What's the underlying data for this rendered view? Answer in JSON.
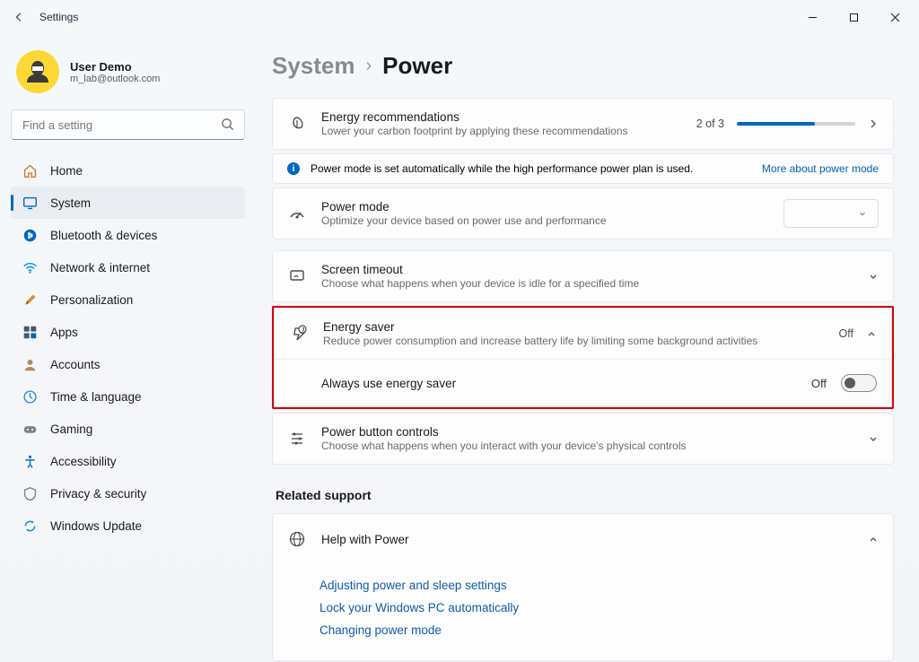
{
  "window": {
    "title": "Settings"
  },
  "profile": {
    "name": "User Demo",
    "email": "m_lab@outlook.com"
  },
  "search": {
    "placeholder": "Find a setting"
  },
  "nav": {
    "items": [
      {
        "label": "Home"
      },
      {
        "label": "System"
      },
      {
        "label": "Bluetooth & devices"
      },
      {
        "label": "Network & internet"
      },
      {
        "label": "Personalization"
      },
      {
        "label": "Apps"
      },
      {
        "label": "Accounts"
      },
      {
        "label": "Time & language"
      },
      {
        "label": "Gaming"
      },
      {
        "label": "Accessibility"
      },
      {
        "label": "Privacy & security"
      },
      {
        "label": "Windows Update"
      }
    ],
    "active_index": 1
  },
  "breadcrumb": {
    "parent": "System",
    "current": "Power"
  },
  "energy_rec": {
    "title": "Energy recommendations",
    "sub": "Lower your carbon footprint by applying these recommendations",
    "progress_text": "2 of 3",
    "progress_percent": 66
  },
  "info_bar": {
    "text": "Power mode is set automatically while the high performance power plan is used.",
    "link": "More about power mode"
  },
  "power_mode": {
    "title": "Power mode",
    "sub": "Optimize your device based on power use and performance"
  },
  "screen_timeout": {
    "title": "Screen timeout",
    "sub": "Choose what happens when your device is idle for a specified time"
  },
  "energy_saver": {
    "title": "Energy saver",
    "sub": "Reduce power consumption and increase battery life by limiting some background activities",
    "state": "Off",
    "sub_option": {
      "title": "Always use energy saver",
      "state": "Off"
    }
  },
  "power_button": {
    "title": "Power button controls",
    "sub": "Choose what happens when you interact with your device's physical controls"
  },
  "related_support": {
    "heading": "Related support",
    "help_title": "Help with Power",
    "links": [
      "Adjusting power and sleep settings",
      "Lock your Windows PC automatically",
      "Changing power mode"
    ]
  }
}
